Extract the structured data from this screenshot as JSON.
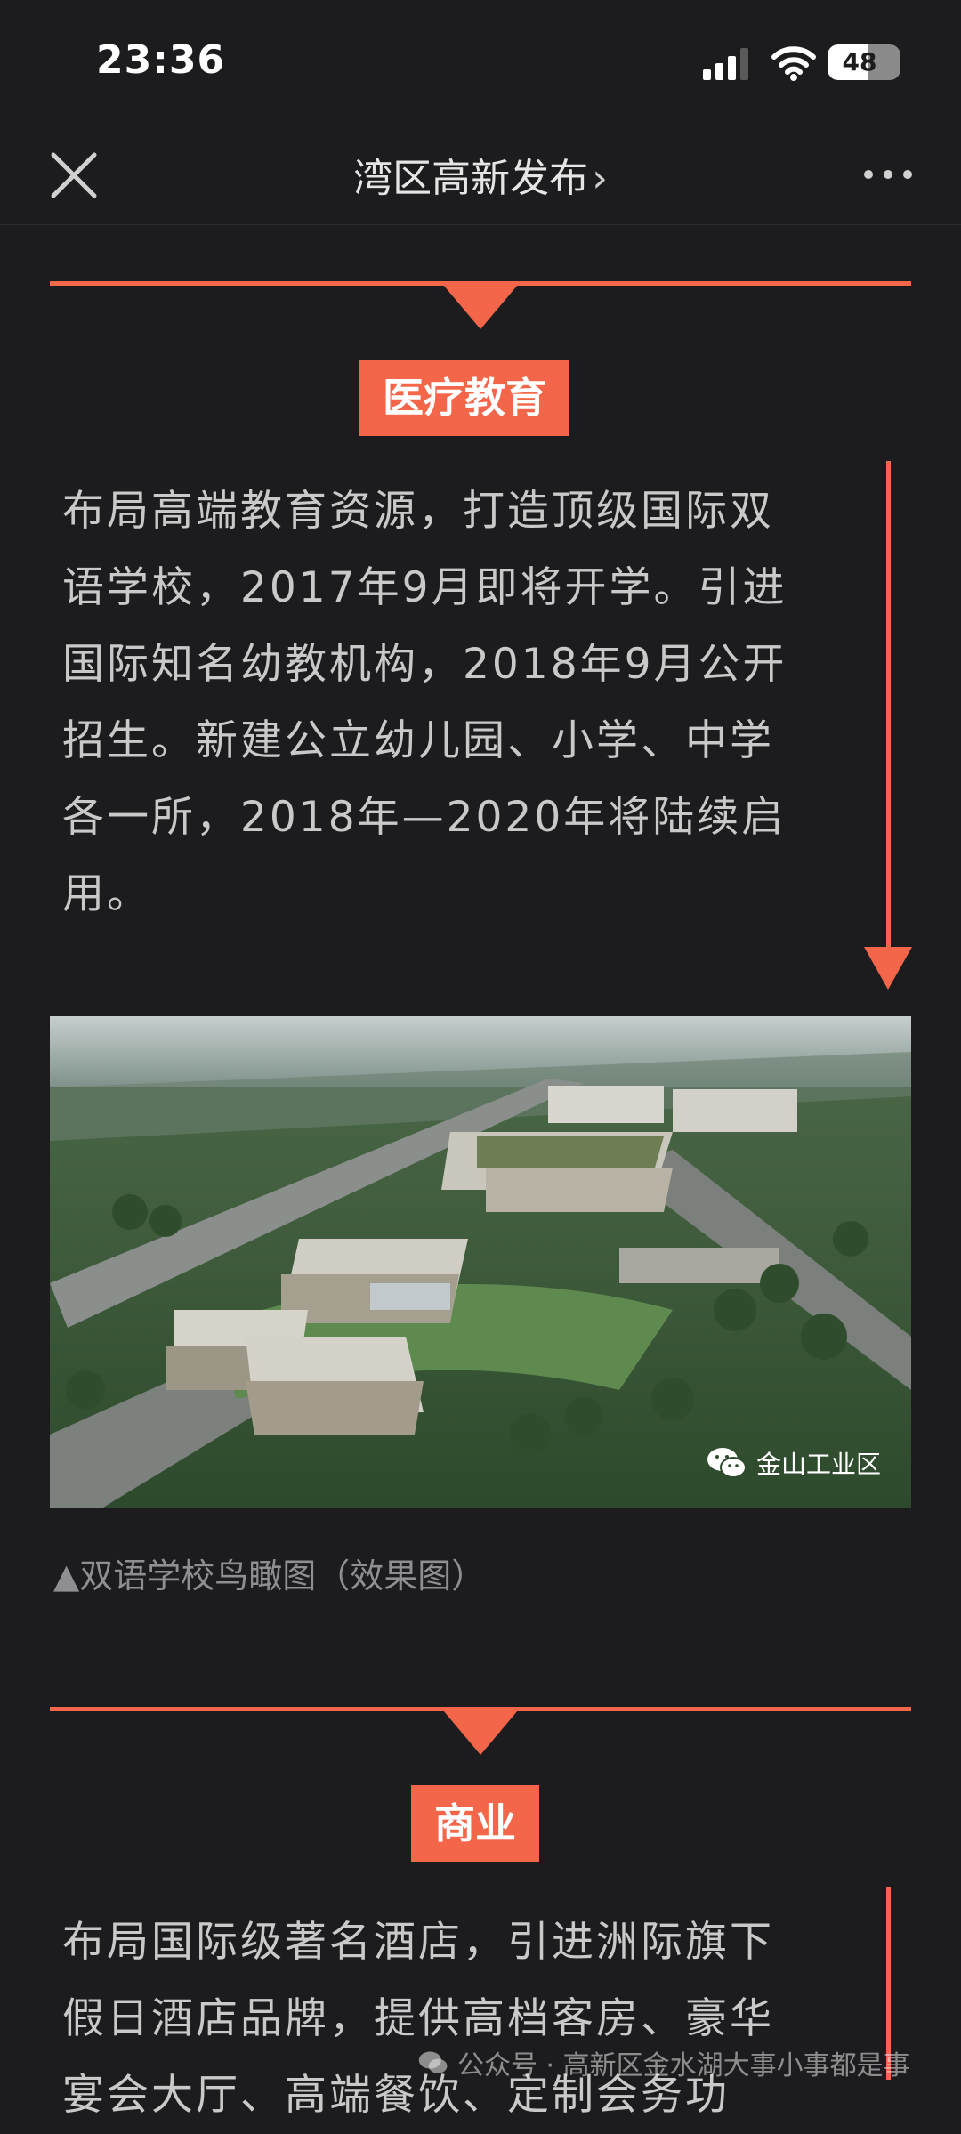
{
  "status_bar": {
    "time": "23:36",
    "battery_level": "48"
  },
  "nav": {
    "title": "湾区高新发布",
    "chevron": "›",
    "close_icon": "close-icon",
    "more_icon": "more-icon"
  },
  "sections": [
    {
      "tag": "医疗教育",
      "lines": [
        "布局高端教育资源，打造顶级国际双",
        "语学校，2017年9月即将开学。引进",
        "国际知名幼教机构，2018年9月公开",
        "招生。新建公立幼儿园、小学、中学",
        "各一所，2018年—2020年将陆续启",
        "用。"
      ]
    },
    {
      "tag": "商业",
      "lines": [
        "布局国际级著名酒店，引进洲际旗下",
        "假日酒店品牌，提供高档客房、豪华",
        "宴会大厅、高端餐饮、定制会务功"
      ]
    }
  ],
  "image": {
    "watermark": "金山工业区",
    "caption": "▲双语学校鸟瞰图（效果图）"
  },
  "footer_watermark": "公众号 · 高新区金水湖大事小事都是事",
  "colors": {
    "accent": "#f4664a",
    "background": "#1c1c1e",
    "text": "#c9c9c9"
  }
}
